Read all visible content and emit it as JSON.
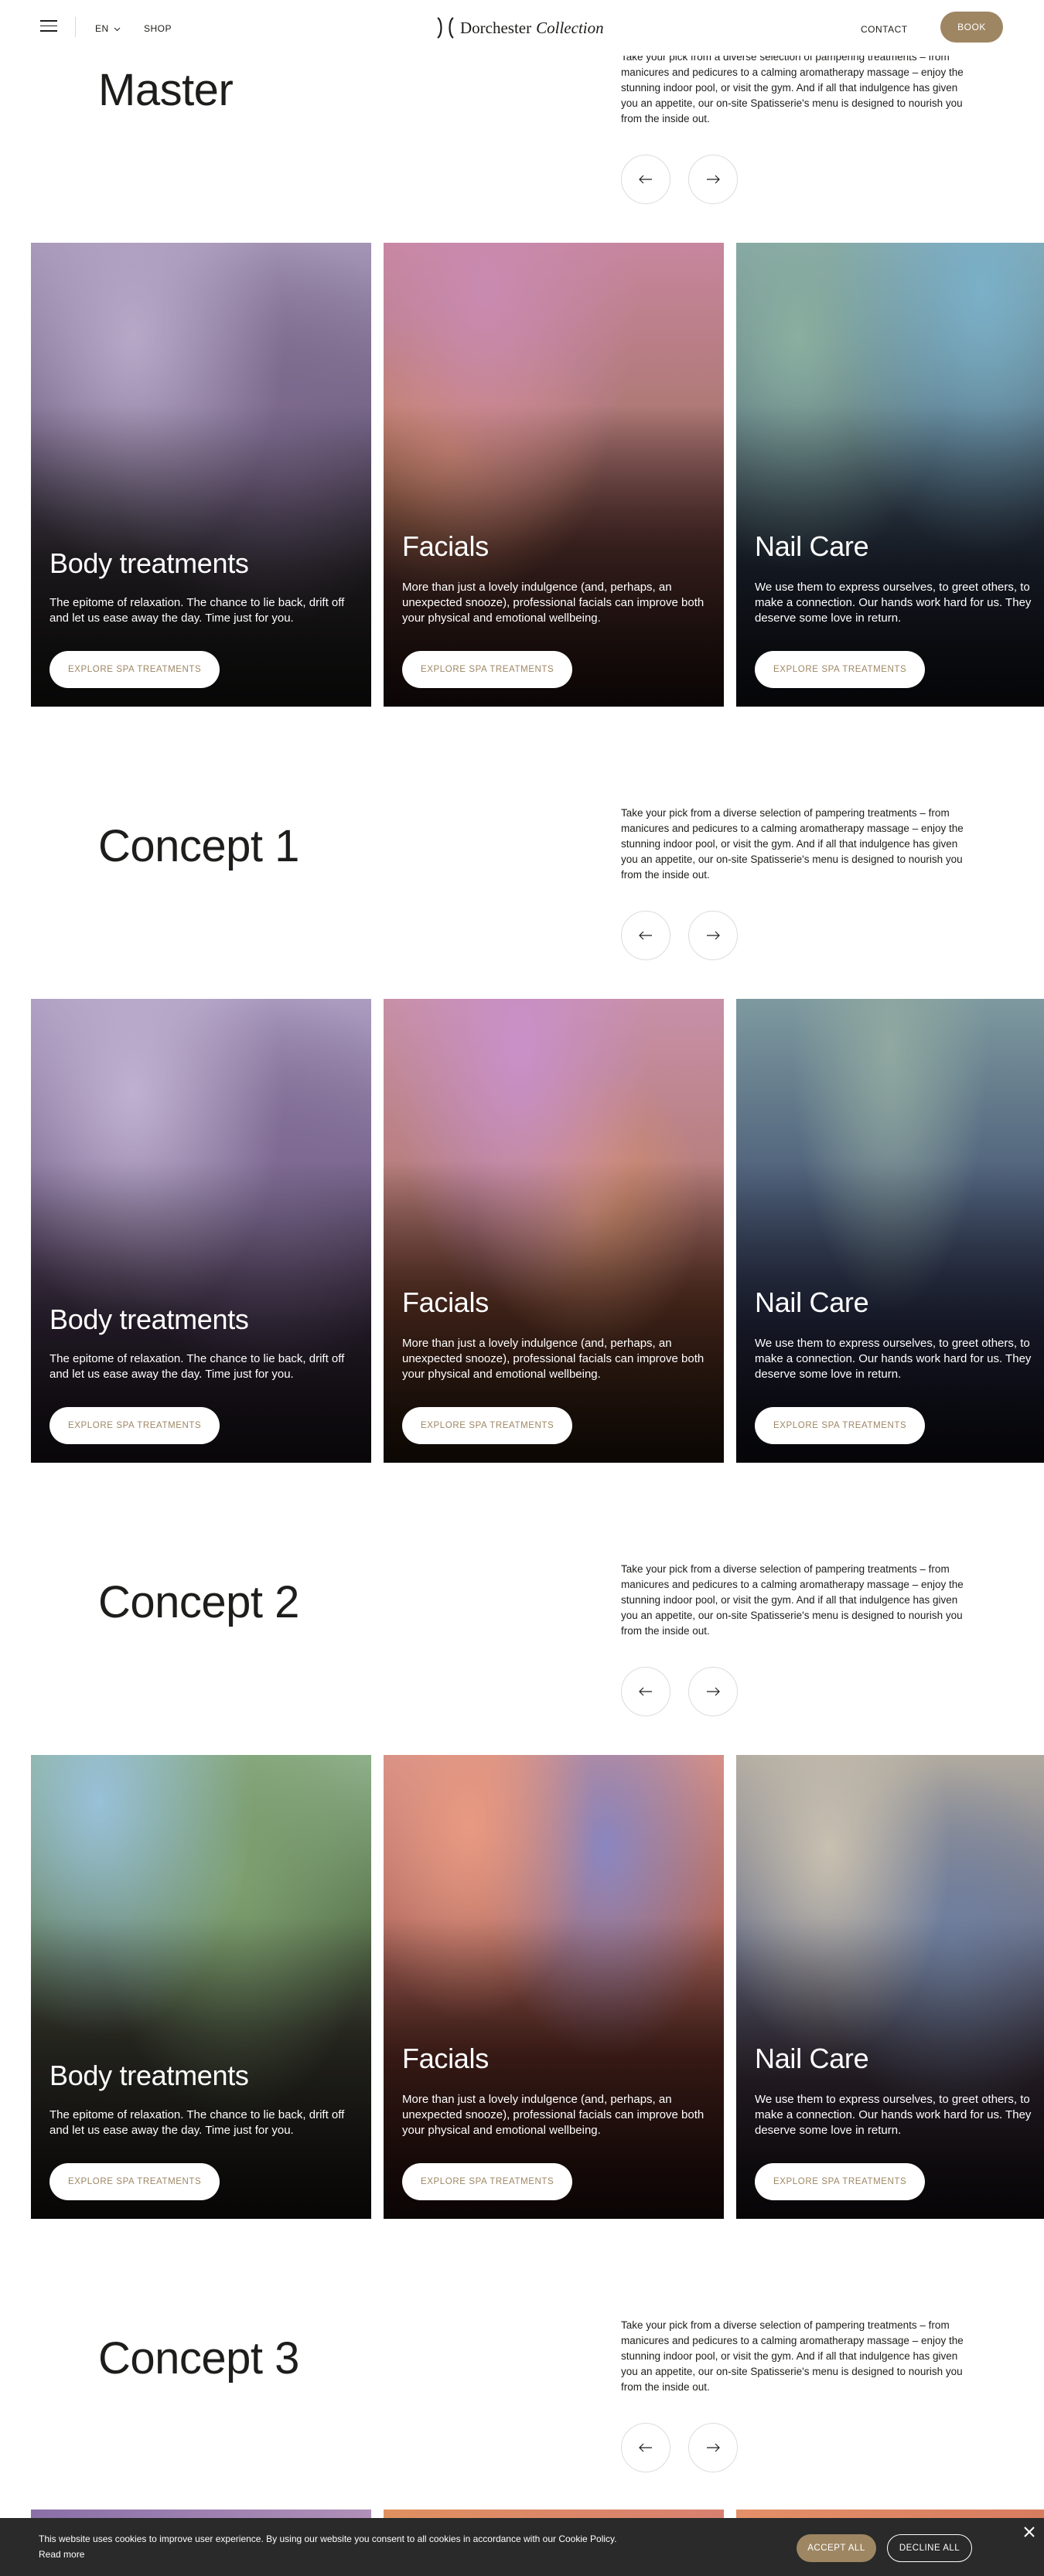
{
  "header": {
    "lang": "EN",
    "shop": "SHOP",
    "logo_name": "Dorchester",
    "logo_collection": "Collection",
    "contact": "CONTACT",
    "book": "BOOK",
    "brand_color": "#9e8663"
  },
  "sections": [
    {
      "title": "Master",
      "description": "Take your pick from a diverse selection of pampering treatments – from manicures and pedicures to a calming aromatherapy massage – enjoy the stunning indoor pool, or visit the gym. And if all that indulgence has given you an appetite, our on-site Spatisserie's menu is designed to nourish you from the inside out.",
      "cards": [
        {
          "title": "Body treatments",
          "text": "The epitome of relaxation. The chance to lie back, drift off and let us ease away the day. Time just for you.",
          "button": "EXPLORE SPA TREATMENTS"
        },
        {
          "title": "Facials",
          "text": "More than just a lovely indulgence (and, perhaps, an unexpected snooze), professional facials can improve both your physical and emotional wellbeing.",
          "button": "EXPLORE SPA TREATMENTS"
        },
        {
          "title": "Nail Care",
          "text": "We use them to express ourselves, to greet others, to make a connection. Our hands work hard for us. They deserve some love in return.",
          "button": "EXPLORE SPA TREATMENTS"
        }
      ]
    },
    {
      "title": "Concept 1",
      "description": "Take your pick from a diverse selection of pampering treatments – from manicures and pedicures to a calming aromatherapy massage – enjoy the stunning indoor pool, or visit the gym. And if all that indulgence has given you an appetite, our on-site Spatisserie's menu is designed to nourish you from the inside out.",
      "cards": [
        {
          "title": "Body treatments",
          "text": "The epitome of relaxation. The chance to lie back, drift off and let us ease away the day. Time just for you.",
          "button": "EXPLORE SPA TREATMENTS"
        },
        {
          "title": "Facials",
          "text": "More than just a lovely indulgence (and, perhaps, an unexpected snooze), professional facials can improve both your physical and emotional wellbeing.",
          "button": "EXPLORE SPA TREATMENTS"
        },
        {
          "title": "Nail Care",
          "text": "We use them to express ourselves, to greet others, to make a connection. Our hands work hard for us. They deserve some love in return.",
          "button": "EXPLORE SPA TREATMENTS"
        }
      ]
    },
    {
      "title": "Concept 2",
      "description": "Take your pick from a diverse selection of pampering treatments – from manicures and pedicures to a calming aromatherapy massage – enjoy the stunning indoor pool, or visit the gym. And if all that indulgence has given you an appetite, our on-site Spatisserie's menu is designed to nourish you from the inside out.",
      "cards": [
        {
          "title": "Body treatments",
          "text": "The epitome of relaxation. The chance to lie back, drift off and let us ease away the day. Time just for you.",
          "button": "EXPLORE SPA TREATMENTS"
        },
        {
          "title": "Facials",
          "text": "More than just a lovely indulgence (and, perhaps, an unexpected snooze), professional facials can improve both your physical and emotional wellbeing.",
          "button": "EXPLORE SPA TREATMENTS"
        },
        {
          "title": "Nail Care",
          "text": "We use them to express ourselves, to greet others, to make a connection. Our hands work hard for us. They deserve some love in return.",
          "button": "EXPLORE SPA TREATMENTS"
        }
      ]
    },
    {
      "title": "Concept 3",
      "description": "Take your pick from a diverse selection of pampering treatments – from manicures and pedicures to a calming aromatherapy massage – enjoy the stunning indoor pool, or visit the gym. And if all that indulgence has given you an appetite, our on-site Spatisserie's menu is designed to nourish you from the inside out."
    }
  ],
  "cookie": {
    "text": "This website uses cookies to improve user experience. By using our website you consent to all cookies in accordance with our Cookie Policy.",
    "read_more": "Read more",
    "accept": "ACCEPT ALL",
    "decline": "DECLINE ALL"
  },
  "icons": {
    "menu": "hamburger-icon",
    "lang_caret": "chevron-down-icon",
    "prev": "arrow-left-icon",
    "next": "arrow-right-icon",
    "close": "close-icon"
  }
}
